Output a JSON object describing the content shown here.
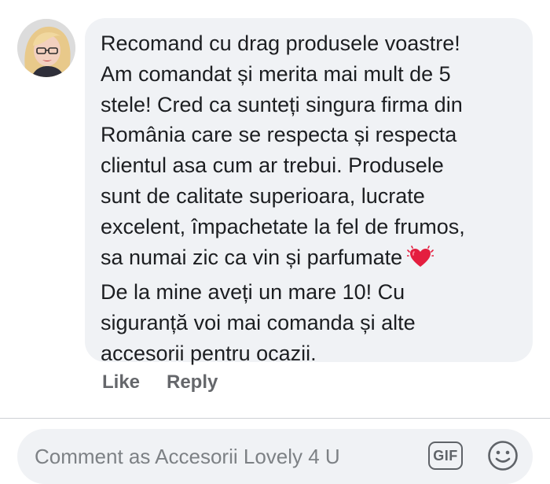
{
  "comment": {
    "lines": [
      "Recomand cu drag produsele voastre!",
      "Am comandat și merita mai mult de 5",
      "stele! Cred ca sunteți singura firma din",
      "România care se respecta și respecta",
      "clientul asa cum ar trebui. Produsele",
      "sunt de calitate superioara, lucrate",
      "excelent, împachetate la fel de frumos,",
      "sa numai zic ca vin și parfumate",
      "De la mine aveți un mare 10! Cu",
      "siguranță voi mai comanda și alte",
      "accesorii pentru ocazii."
    ],
    "emoji_icon": "beating-heart-icon",
    "actions": {
      "like_label": "Like",
      "reply_label": "Reply"
    }
  },
  "composer": {
    "placeholder": "Comment as Accesorii  Lovely 4 U",
    "gif_label": "GIF",
    "emoji_icon": "smiley-face-icon"
  },
  "colors": {
    "bubble_bg": "#f0f2f5",
    "text": "#1c1e21",
    "secondary_text": "#65676b",
    "heart": "#e41e3f"
  }
}
